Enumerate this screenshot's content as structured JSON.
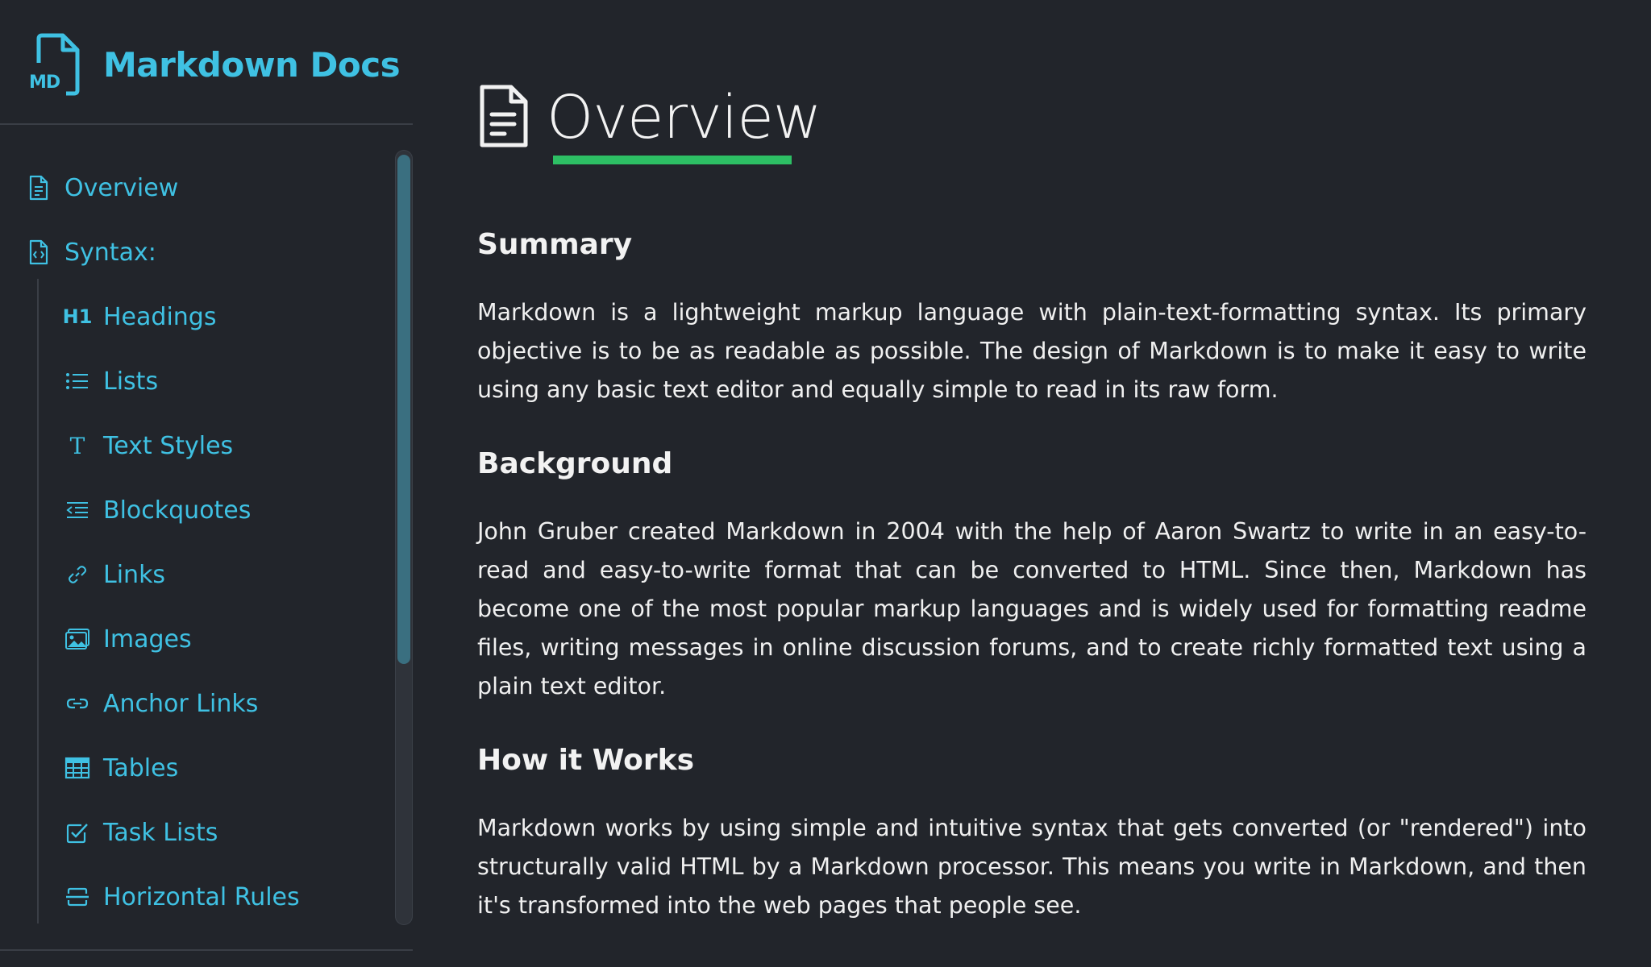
{
  "sidebar": {
    "brand": {
      "badge": "MD",
      "title": "Markdown Docs"
    },
    "nav": [
      {
        "id": "overview",
        "label": "Overview",
        "icon": "document-icon",
        "level": 0
      },
      {
        "id": "syntax",
        "label": "Syntax:",
        "icon": "code-file-icon",
        "level": 0
      },
      {
        "id": "headings",
        "label": "Headings",
        "icon": "h1-icon",
        "icon_text": "H1",
        "level": 1
      },
      {
        "id": "lists",
        "label": "Lists",
        "icon": "list-icon",
        "level": 1
      },
      {
        "id": "text-styles",
        "label": "Text Styles",
        "icon": "text-style-icon",
        "icon_text": "T",
        "level": 1
      },
      {
        "id": "blockquotes",
        "label": "Blockquotes",
        "icon": "blockquote-icon",
        "level": 1
      },
      {
        "id": "links",
        "label": "Links",
        "icon": "link-icon",
        "level": 1
      },
      {
        "id": "images",
        "label": "Images",
        "icon": "image-icon",
        "level": 1
      },
      {
        "id": "anchor-links",
        "label": "Anchor Links",
        "icon": "anchor-link-icon",
        "level": 1
      },
      {
        "id": "tables",
        "label": "Tables",
        "icon": "table-icon",
        "level": 1
      },
      {
        "id": "task-lists",
        "label": "Task Lists",
        "icon": "checkbox-icon",
        "level": 1
      },
      {
        "id": "horizontal-rules",
        "label": "Horizontal Rules",
        "icon": "horizontal-rule-icon",
        "level": 1
      }
    ]
  },
  "main": {
    "title": "Overview",
    "sections": [
      {
        "heading": "Summary",
        "text": "Markdown is a lightweight markup language with plain-text-formatting syntax. Its primary objective is to be as readable as possible. The design of Markdown is to make it easy to write using any basic text editor and equally simple to read in its raw form."
      },
      {
        "heading": "Background",
        "text": "John Gruber created Markdown in 2004 with the help of Aaron Swartz to write in an easy-to-read and easy-to-write format that can be converted to HTML. Since then, Markdown has become one of the most popular markup languages and is widely used for formatting readme files, writing messages in online discussion forums, and to create richly formatted text using a plain text editor."
      },
      {
        "heading": "How it Works",
        "text": "Markdown works by using simple and intuitive syntax that gets converted (or \"rendered\") into structurally valid HTML by a Markdown processor. This means you write in Markdown, and then it's transformed into the web pages that people see."
      }
    ]
  },
  "colors": {
    "background": "#22252b",
    "accent": "#3fc1e3",
    "title_underline": "#2dbf64",
    "text": "#f0f0f0"
  }
}
